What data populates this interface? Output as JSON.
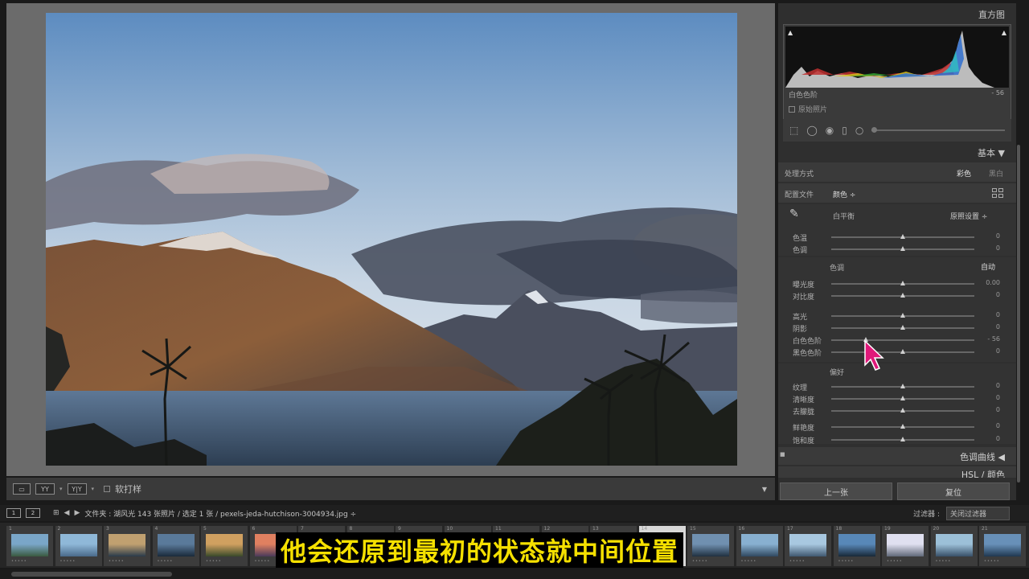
{
  "histogram": {
    "title": "直方图",
    "label": "白色色阶",
    "value": "- 56",
    "original_photo": "原始照片"
  },
  "basic": {
    "title": "基本",
    "treatment_label": "处理方式",
    "treatment_color": "彩色",
    "treatment_bw": "黑白",
    "profile_label": "配置文件",
    "profile_value": "颜色 ÷",
    "wb_label": "白平衡",
    "wb_value": "原照设置 ÷",
    "sliders_wb": [
      {
        "label": "色温",
        "value": "0",
        "pos": 0.5
      },
      {
        "label": "色调",
        "value": "0",
        "pos": 0.5
      }
    ],
    "tone_label": "色调",
    "tone_auto": "自动",
    "sliders_tone": [
      {
        "label": "曝光度",
        "value": "0.00",
        "pos": 0.5
      },
      {
        "label": "对比度",
        "value": "0",
        "pos": 0.5
      }
    ],
    "sliders_tone2": [
      {
        "label": "高光",
        "value": "0",
        "pos": 0.5
      },
      {
        "label": "阴影",
        "value": "0",
        "pos": 0.5
      },
      {
        "label": "白色色阶",
        "value": "- 56",
        "pos": 0.24
      },
      {
        "label": "黑色色阶",
        "value": "0",
        "pos": 0.5
      }
    ],
    "presence_label": "偏好",
    "sliders_presence": [
      {
        "label": "纹理",
        "value": "0",
        "pos": 0.5
      },
      {
        "label": "清晰度",
        "value": "0",
        "pos": 0.5
      },
      {
        "label": "去朦胧",
        "value": "0",
        "pos": 0.5
      }
    ],
    "sliders_color": [
      {
        "label": "鲜艳度",
        "value": "0",
        "pos": 0.5
      },
      {
        "label": "饱和度",
        "value": "0",
        "pos": 0.5
      }
    ]
  },
  "panels": {
    "tone_curve": "色调曲线",
    "hsl": "HSL / 颜色"
  },
  "buttons": {
    "previous": "上一张",
    "reset": "复位"
  },
  "toolbar": {
    "soft_proof": "软打样"
  },
  "filmstrip_header": {
    "monitor1": "1",
    "monitor2": "2",
    "path": "文件夹 : 湖风光   143 张照片 / 选定 1 张 / pexels-jeda-hutchison-3004934.jpg ÷",
    "filter_label": "过滤器 :",
    "filter_value": "关闭过滤器"
  },
  "filmstrip": {
    "numbers": [
      "1",
      "2",
      "3",
      "4",
      "5",
      "6",
      "7",
      "8",
      "9",
      "10",
      "11",
      "12",
      "13",
      "14",
      "15",
      "16",
      "17",
      "18",
      "19",
      "20",
      "21"
    ]
  },
  "subtitle": "他会还原到最初的状态就中间位置",
  "colors": {
    "accent_cursor": "#e0187a",
    "subtitle_text": "#f5e000"
  }
}
